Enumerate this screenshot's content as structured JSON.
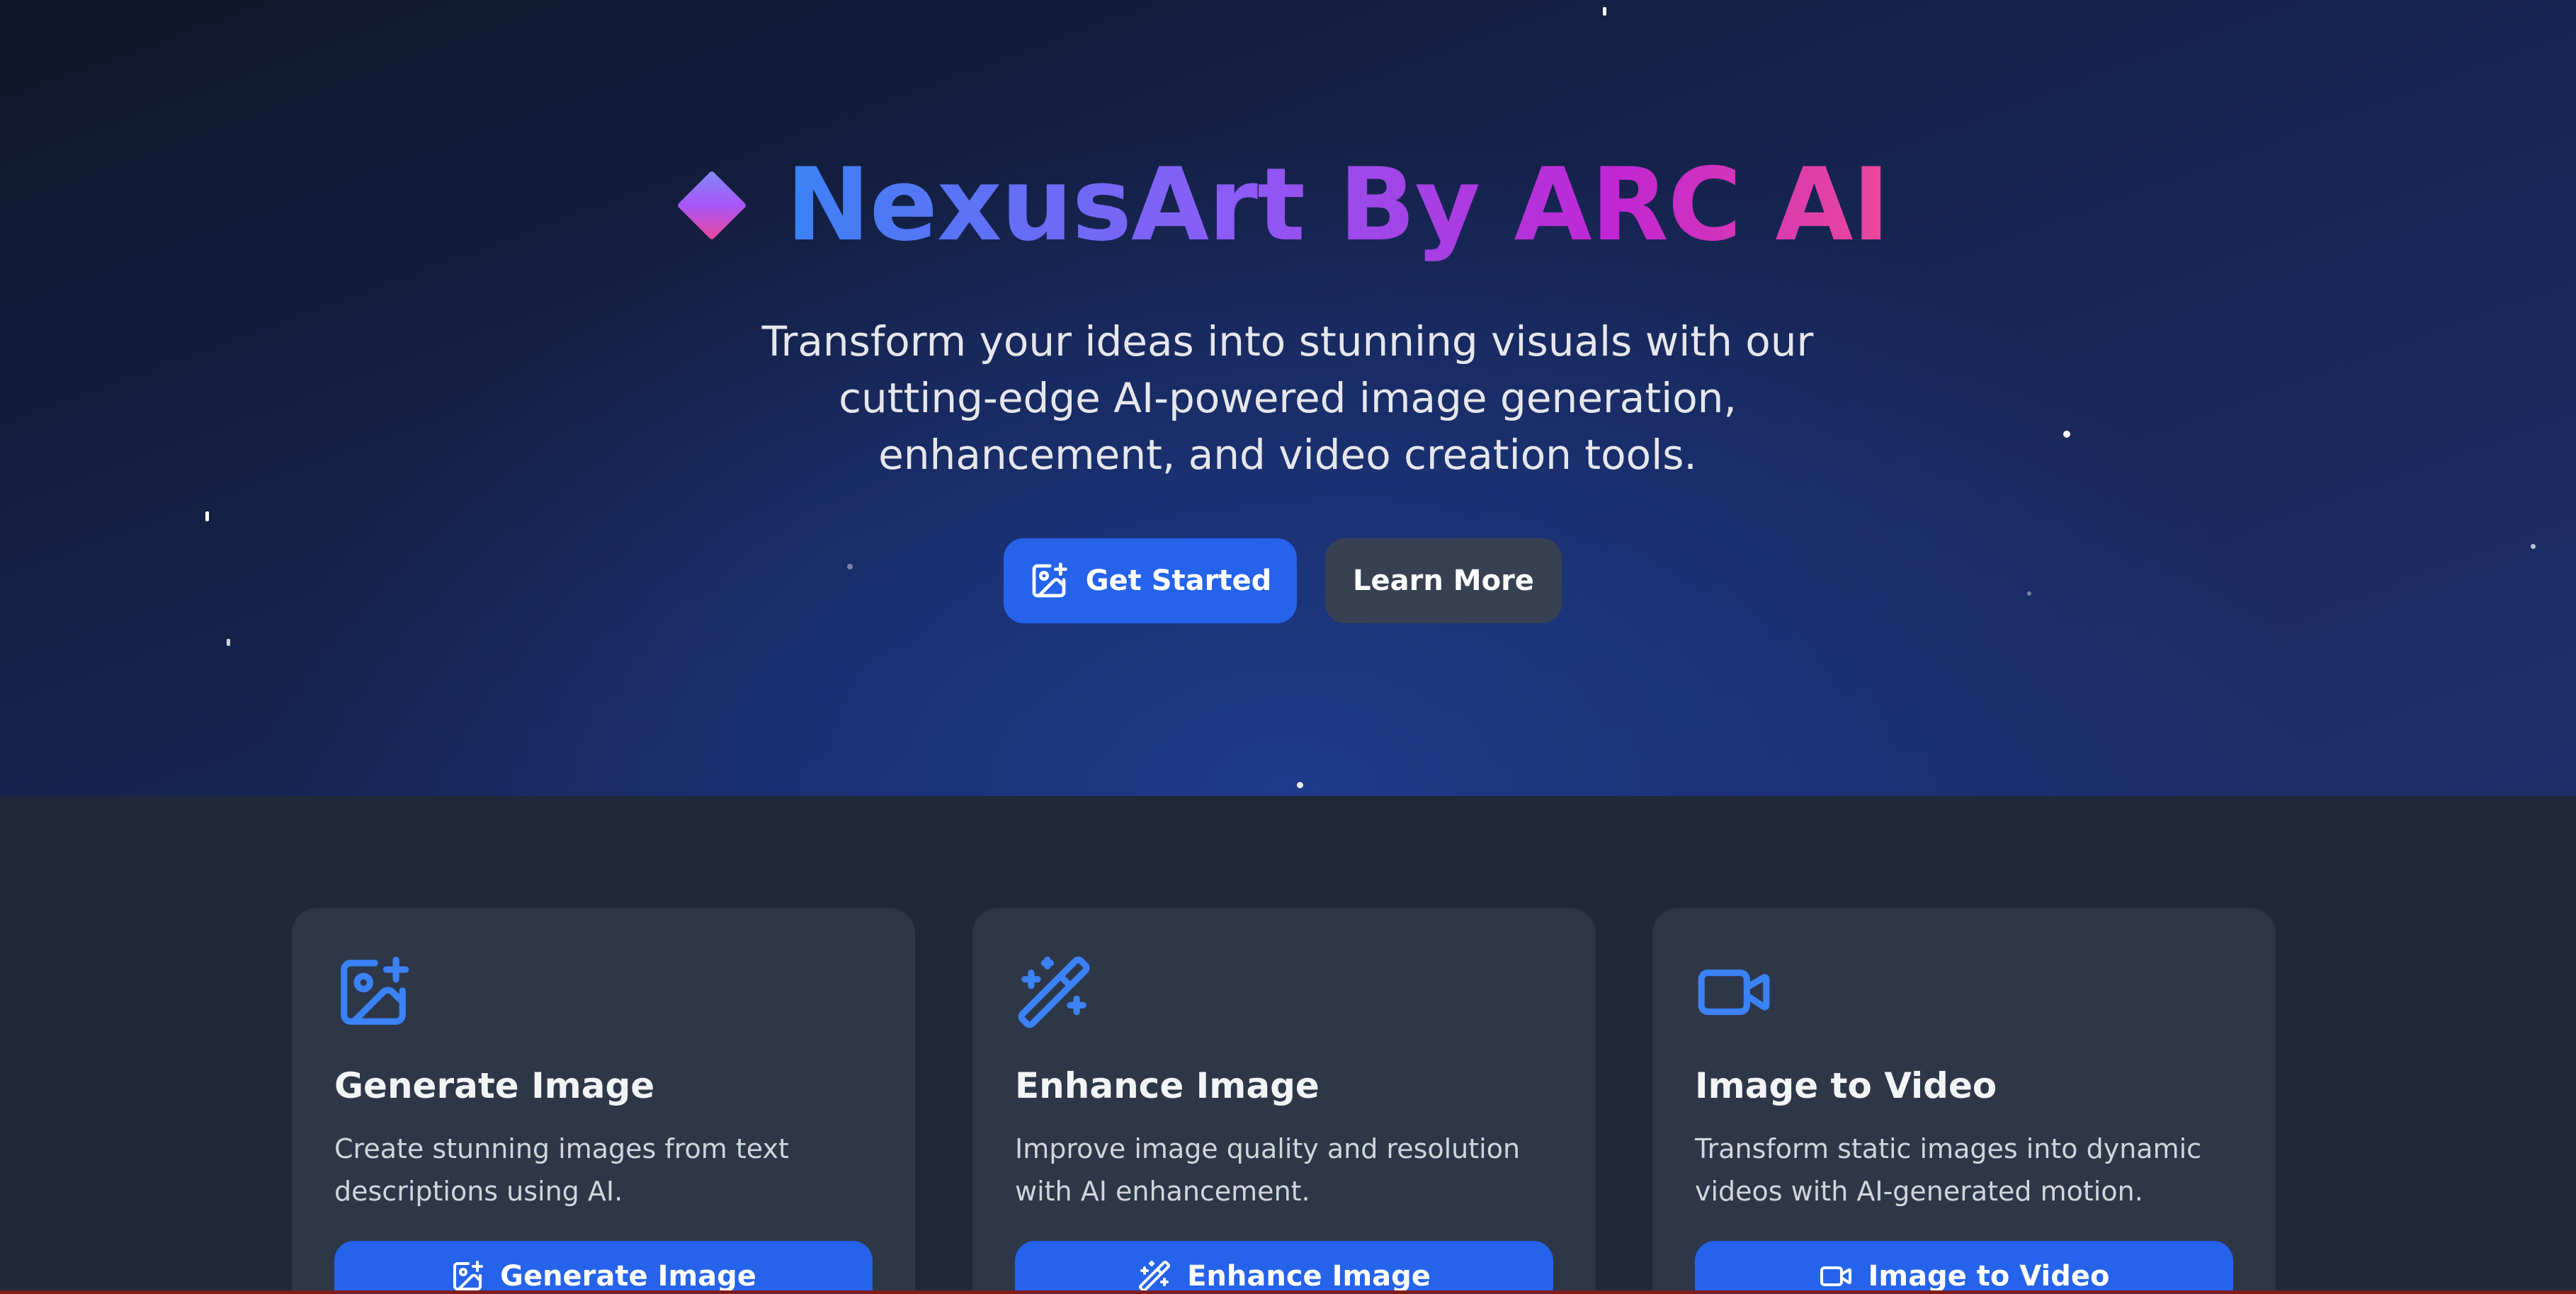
{
  "hero": {
    "title": "NexusArt By ARC AI",
    "subtitle": "Transform your ideas into stunning visuals with our cutting-edge AI-powered image generation, enhancement, and video creation tools.",
    "get_started_label": "Get Started",
    "learn_more_label": "Learn More",
    "logo_icon": "diamond-icon"
  },
  "features": [
    {
      "icon": "image-plus-icon",
      "title": "Generate Image",
      "description": "Create stunning images from text descriptions using AI.",
      "button_label": "Generate Image"
    },
    {
      "icon": "magic-wand-icon",
      "title": "Enhance Image",
      "description": "Improve image quality and resolution with AI enhancement.",
      "button_label": "Enhance Image"
    },
    {
      "icon": "video-camera-icon",
      "title": "Image to Video",
      "description": "Transform static images into dynamic videos with AI-generated motion.",
      "button_label": "Image to Video"
    }
  ],
  "colors": {
    "accent": "#2563eb",
    "icon_blue": "#3b82f6",
    "card_bg": "#2d3748",
    "gradient_start": "#3b82f6",
    "gradient_mid": "#8b5cf6",
    "gradient_end": "#ec4899"
  }
}
